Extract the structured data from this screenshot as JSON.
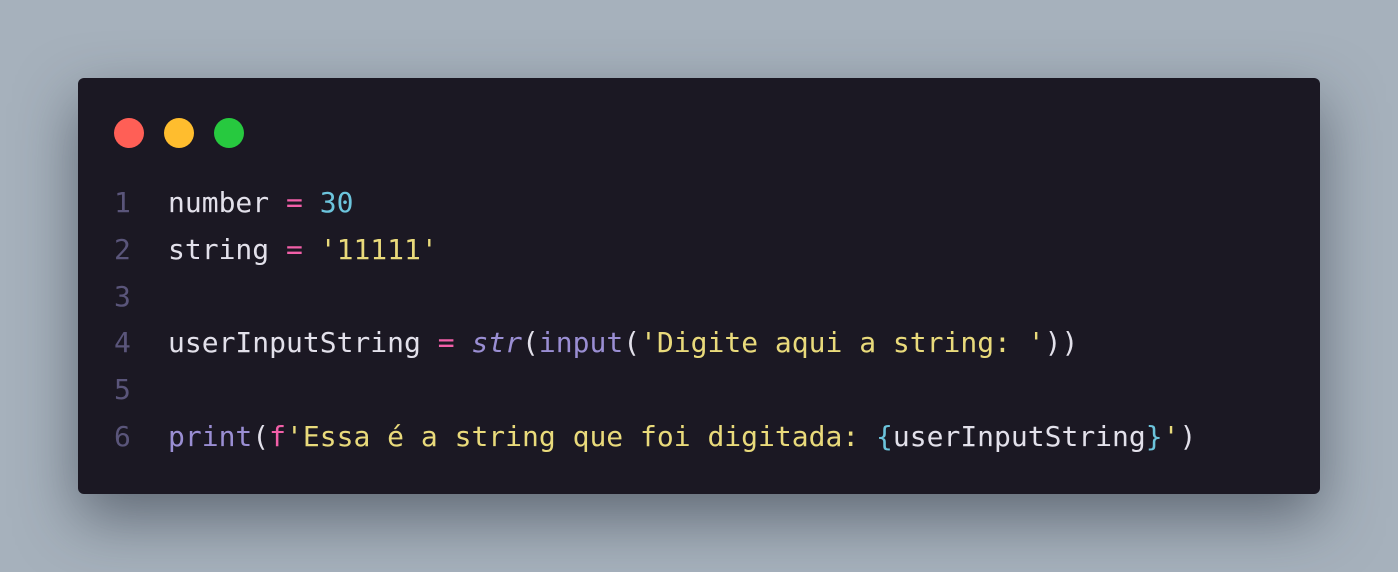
{
  "window": {
    "colors": {
      "background": "#1b1823",
      "page_background": "#a6b1bc",
      "dot_close": "#ff5f56",
      "dot_minimize": "#ffbd2e",
      "dot_maximize": "#27c93f"
    }
  },
  "code": {
    "lines": [
      {
        "number": "1",
        "tokens": [
          {
            "text": "number",
            "type": "var"
          },
          {
            "text": " ",
            "type": "punc"
          },
          {
            "text": "=",
            "type": "op"
          },
          {
            "text": " ",
            "type": "punc"
          },
          {
            "text": "30",
            "type": "num"
          }
        ]
      },
      {
        "number": "2",
        "tokens": [
          {
            "text": "string",
            "type": "var"
          },
          {
            "text": " ",
            "type": "punc"
          },
          {
            "text": "=",
            "type": "op"
          },
          {
            "text": " ",
            "type": "punc"
          },
          {
            "text": "'11111'",
            "type": "str"
          }
        ]
      },
      {
        "number": "3",
        "tokens": []
      },
      {
        "number": "4",
        "tokens": [
          {
            "text": "userInputString",
            "type": "var"
          },
          {
            "text": " ",
            "type": "punc"
          },
          {
            "text": "=",
            "type": "op"
          },
          {
            "text": " ",
            "type": "punc"
          },
          {
            "text": "str",
            "type": "builtin-italic"
          },
          {
            "text": "(",
            "type": "punc"
          },
          {
            "text": "input",
            "type": "builtin"
          },
          {
            "text": "(",
            "type": "punc"
          },
          {
            "text": "'Digite aqui a string: '",
            "type": "str"
          },
          {
            "text": "))",
            "type": "punc"
          }
        ]
      },
      {
        "number": "5",
        "tokens": []
      },
      {
        "number": "6",
        "tokens": [
          {
            "text": "print",
            "type": "builtin"
          },
          {
            "text": "(",
            "type": "punc"
          },
          {
            "text": "f",
            "type": "fprefix"
          },
          {
            "text": "'Essa é a string que foi digitada: ",
            "type": "str"
          },
          {
            "text": "{",
            "type": "brace"
          },
          {
            "text": "userInputString",
            "type": "var"
          },
          {
            "text": "}",
            "type": "brace"
          },
          {
            "text": "'",
            "type": "str"
          },
          {
            "text": ")",
            "type": "punc"
          }
        ]
      }
    ]
  }
}
